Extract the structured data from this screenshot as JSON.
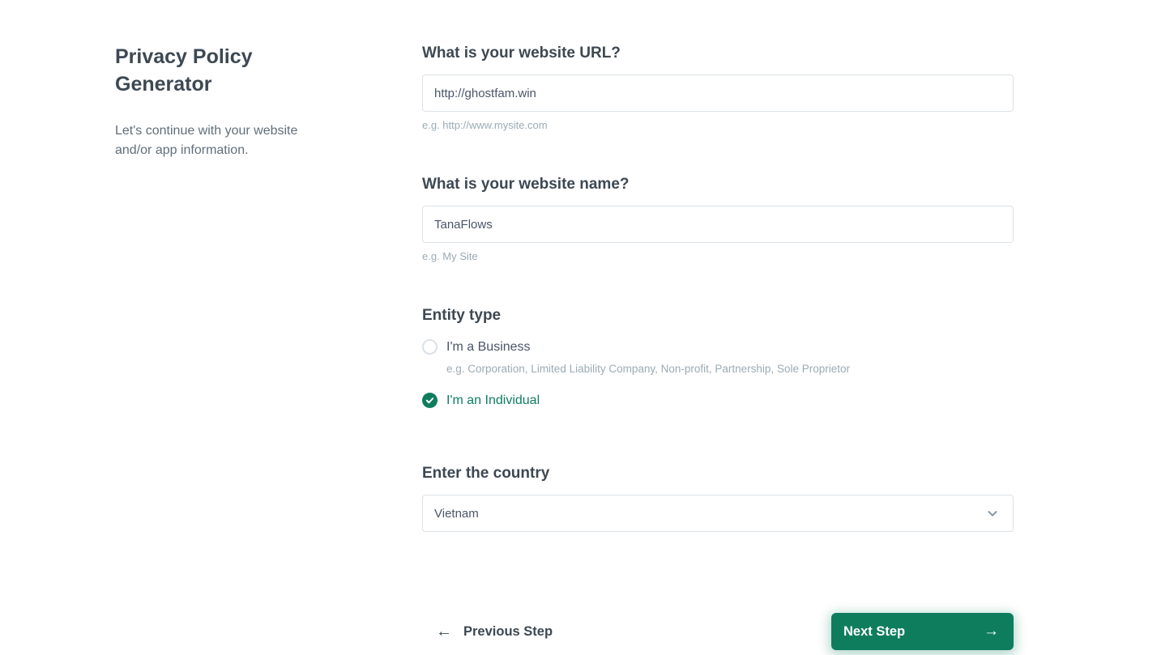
{
  "sidebar": {
    "title": "Privacy Policy Generator",
    "subtitle": "Let's continue with your website and/or app information."
  },
  "form": {
    "website_url": {
      "label": "What is your website URL?",
      "value": "http://ghostfam.win",
      "hint": "e.g. http://www.mysite.com"
    },
    "website_name": {
      "label": "What is your website name?",
      "value": "TanaFlows",
      "hint": "e.g. My Site"
    },
    "entity_type": {
      "label": "Entity type",
      "options": [
        {
          "label": "I'm a Business",
          "hint": "e.g. Corporation, Limited Liability Company, Non-profit, Partnership, Sole Proprietor",
          "selected": false
        },
        {
          "label": "I'm an Individual",
          "selected": true
        }
      ]
    },
    "country": {
      "label": "Enter the country",
      "value": "Vietnam"
    }
  },
  "footer": {
    "previous_arrow": "←",
    "previous_label": "Previous Step",
    "next_label": "Next Step",
    "next_arrow": "→"
  },
  "colors": {
    "accent_green": "#0e7d5e",
    "heading": "#3d4852",
    "muted": "#606f7b",
    "hint": "#9babb4",
    "border": "#dbe1e6"
  }
}
